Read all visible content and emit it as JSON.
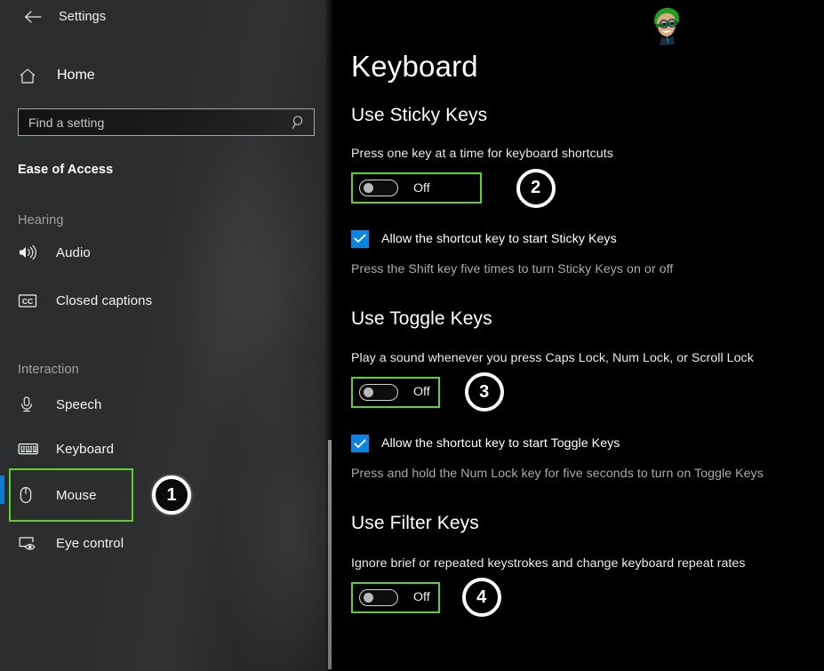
{
  "window": {
    "app_title": "Settings",
    "back_icon": "back-arrow-icon"
  },
  "sidebar": {
    "home": {
      "label": "Home",
      "icon": "home-icon"
    },
    "search": {
      "value": "",
      "placeholder": "Find a setting",
      "icon": "search-icon"
    },
    "category_title": "Ease of Access",
    "groups": [
      {
        "label": "Hearing",
        "items": [
          {
            "label": "Audio",
            "icon": "speaker-icon",
            "selected": false
          },
          {
            "label": "Closed captions",
            "icon": "closed-captions-icon",
            "selected": false
          }
        ]
      },
      {
        "label": "Interaction",
        "items": [
          {
            "label": "Speech",
            "icon": "microphone-icon",
            "selected": false
          },
          {
            "label": "Keyboard",
            "icon": "keyboard-icon",
            "selected": true
          },
          {
            "label": "Mouse",
            "icon": "mouse-icon",
            "selected": false
          },
          {
            "label": "Eye control",
            "icon": "eye-control-icon",
            "selected": false
          }
        ]
      }
    ]
  },
  "main": {
    "page_title": "Keyboard",
    "avatar_icon": "cartoon-avatar-icon",
    "sections": [
      {
        "heading": "Use Sticky Keys",
        "description": "Press one key at a time for keyboard shortcuts",
        "toggle_state": "Off",
        "checkbox_label": "Allow the shortcut key to start Sticky Keys",
        "checkbox_checked": true,
        "hint": "Press the Shift key five times to turn Sticky Keys on or off",
        "badge": "2"
      },
      {
        "heading": "Use Toggle Keys",
        "description": "Play a sound whenever you press Caps Lock, Num Lock, or Scroll Lock",
        "toggle_state": "Off",
        "checkbox_label": "Allow the shortcut key to start Toggle Keys",
        "checkbox_checked": true,
        "hint": "Press and hold the Num Lock key for five seconds to turn on Toggle Keys",
        "badge": "3"
      },
      {
        "heading": "Use Filter Keys",
        "description": "Ignore brief or repeated keystrokes and change keyboard repeat rates",
        "toggle_state": "Off",
        "badge": "4"
      }
    ]
  },
  "annotations": {
    "sidebar_badge": "1",
    "highlight_color": "#5bd32a",
    "accent_color": "#0a7cd4",
    "checkbox_color": "#0a84e0"
  }
}
